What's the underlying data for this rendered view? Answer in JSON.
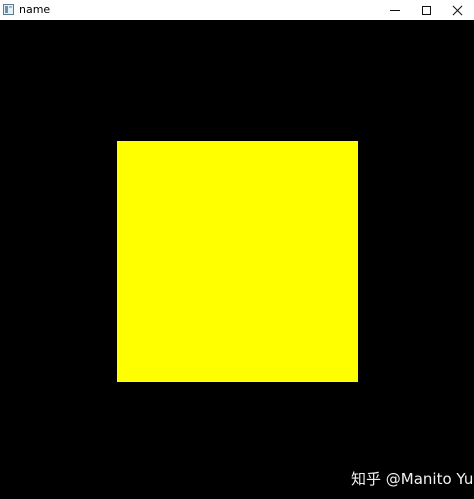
{
  "window": {
    "title": "name",
    "icon": "app-window-icon",
    "controls": [
      "minimize-icon",
      "maximize-icon",
      "close-icon"
    ]
  },
  "canvas": {
    "background_color": "#000000",
    "square_color": "#ffff00"
  },
  "watermark": {
    "text": "知乎 @Manito Yu"
  }
}
